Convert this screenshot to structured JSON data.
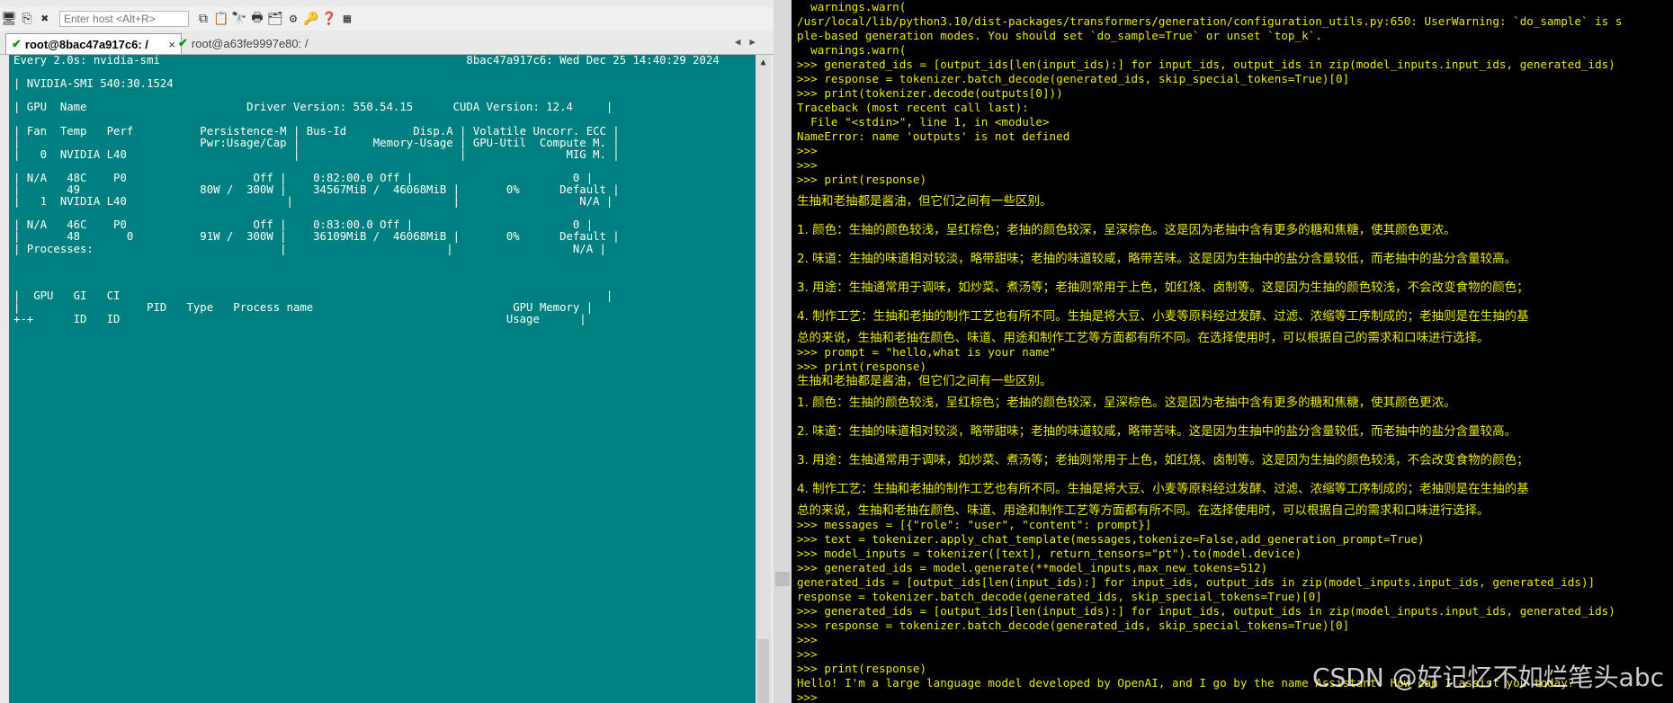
{
  "colors": {
    "terminal_left_bg": "#008080",
    "terminal_right_bg": "#000000",
    "terminal_right_fg": "#e8e800",
    "tab_check": "#0a9a0a"
  },
  "toolbar": {
    "host_placeholder": "Enter host <Alt+R>"
  },
  "tabs": [
    {
      "label": "root@8bac47a917c6: /",
      "active": true
    },
    {
      "label": "root@a63fe9997e80: /",
      "active": false
    }
  ],
  "left_terminal": {
    "lines": [
      "Every 2.0s: nvidia-smi                                              8bac47a917c6: Wed Dec 25 14:40:29 2024",
      "",
      "| NVIDIA-SMI 540:30.1524",
      "",
      "| GPU  Name                        Driver Version: 550.54.15      CUDA Version: 12.4     |",
      "",
      "| Fan  Temp   Perf          Persistence-M | Bus-Id          Disp.A | Volatile Uncorr. ECC |",
      "|                           Pwr:Usage/Cap |           Memory-Usage | GPU-Util  Compute M. |",
      "|   0  NVIDIA L40                         |                        |               MIG M. |",
      "",
      "| N/A   48C    P0                   Off |    0:82:00.0 Off |                        0 |",
      "|       49                  80W /  300W |    34567MiB /  46068MiB |       0%      Default |",
      "|   1  NVIDIA L40                        |                        |                  N/A |",
      "",
      "| N/A   46C    P0                   Off |    0:83:00.0 Off |                        0 |",
      "|       48       0          91W /  300W |    36109MiB /  46068MiB |       0%      Default |",
      "| Processes:                            |                        |                  N/A |",
      "",
      "",
      "",
      "|  GPU   GI   CI                                                                         |",
      "|                   PID   Type   Process name                              GPU Memory |",
      "+-+      ID   ID                                                          Usage      |"
    ]
  },
  "right_terminal": {
    "lines": [
      {
        "t": "  warnings.warn(",
        "k": "a"
      },
      {
        "t": "/usr/local/lib/python3.10/dist-packages/transformers/generation/configuration_utils.py:650: UserWarning: `do_sample` is s",
        "k": "a"
      },
      {
        "t": "ple-based generation modes. You should set `do_sample=True` or unset `top_k`.",
        "k": "a"
      },
      {
        "t": "  warnings.warn(",
        "k": "a"
      },
      {
        "t": ">>> generated_ids = [output_ids[len(input_ids):] for input_ids, output_ids in zip(model_inputs.input_ids, generated_ids)",
        "k": "a"
      },
      {
        "t": ">>> response = tokenizer.batch_decode(generated_ids, skip_special_tokens=True)[0]",
        "k": "a"
      },
      {
        "t": ">>> print(tokenizer.decode(outputs[0]))",
        "k": "a"
      },
      {
        "t": "Traceback (most recent call last):",
        "k": "a"
      },
      {
        "t": "  File \"<stdin>\", line 1, in <module>",
        "k": "a"
      },
      {
        "t": "NameError: name 'outputs' is not defined",
        "k": "a"
      },
      {
        "t": ">>>",
        "k": "a"
      },
      {
        "t": ">>>",
        "k": "a"
      },
      {
        "t": ">>> print(response)",
        "k": "a"
      },
      {
        "t": "生抽和老抽都是酱油，但它们之间有一些区别。",
        "k": "c"
      },
      {
        "t": "1. 颜色：生抽的颜色较浅，呈红棕色；老抽的颜色较深，呈深棕色。这是因为老抽中含有更多的糖和焦糖，使其颜色更浓。",
        "k": "c"
      },
      {
        "t": "2. 味道：生抽的味道相对较淡，略带甜味；老抽的味道较咸，略带苦味。这是因为生抽中的盐分含量较低，而老抽中的盐分含量较高。",
        "k": "c"
      },
      {
        "t": "3. 用途：生抽通常用于调味，如炒菜、煮汤等；老抽则常用于上色，如红烧、卤制等。这是因为生抽的颜色较浅，不会改变食物的颜色；",
        "k": "c"
      },
      {
        "t": "4. 制作工艺：生抽和老抽的制作工艺也有所不同。生抽是将大豆、小麦等原料经过发酵、过滤、浓缩等工序制成的；老抽则是在生抽的基",
        "k": "c"
      },
      {
        "t": "总的来说，生抽和老抽在颜色、味道、用途和制作工艺等方面都有所不同。在选择使用时，可以根据自己的需求和口味进行选择。",
        "k": "t"
      },
      {
        "t": ">>> prompt = \"hello,what is your name\"",
        "k": "a"
      },
      {
        "t": ">>> print(response)",
        "k": "a"
      },
      {
        "t": "生抽和老抽都是酱油，但它们之间有一些区别。",
        "k": "t"
      },
      {
        "t": "1. 颜色：生抽的颜色较浅，呈红棕色；老抽的颜色较深，呈深棕色。这是因为老抽中含有更多的糖和焦糖，使其颜色更浓。",
        "k": "c"
      },
      {
        "t": "2. 味道：生抽的味道相对较淡，略带甜味；老抽的味道较咸，略带苦味。这是因为生抽中的盐分含量较低，而老抽中的盐分含量较高。",
        "k": "c"
      },
      {
        "t": "3. 用途：生抽通常用于调味，如炒菜、煮汤等；老抽则常用于上色，如红烧、卤制等。这是因为生抽的颜色较浅，不会改变食物的颜色；",
        "k": "c"
      },
      {
        "t": "4. 制作工艺：生抽和老抽的制作工艺也有所不同。生抽是将大豆、小麦等原料经过发酵、过滤、浓缩等工序制成的；老抽则是在生抽的基",
        "k": "c"
      },
      {
        "t": "总的来说，生抽和老抽在颜色、味道、用途和制作工艺等方面都有所不同。在选择使用时，可以根据自己的需求和口味进行选择。",
        "k": "t"
      },
      {
        "t": ">>> messages = [{\"role\": \"user\", \"content\": prompt}]",
        "k": "a"
      },
      {
        "t": ">>> text = tokenizer.apply_chat_template(messages,tokenize=False,add_generation_prompt=True)",
        "k": "a"
      },
      {
        "t": ">>> model_inputs = tokenizer([text], return_tensors=\"pt\").to(model.device)",
        "k": "a"
      },
      {
        "t": ">>> generated_ids = model.generate(**model_inputs,max_new_tokens=512)",
        "k": "a"
      },
      {
        "t": "generated_ids = [output_ids[len(input_ids):] for input_ids, output_ids in zip(model_inputs.input_ids, generated_ids)]",
        "k": "a"
      },
      {
        "t": "response = tokenizer.batch_decode(generated_ids, skip_special_tokens=True)[0]",
        "k": "a"
      },
      {
        "t": ">>> generated_ids = [output_ids[len(input_ids):] for input_ids, output_ids in zip(model_inputs.input_ids, generated_ids)",
        "k": "a"
      },
      {
        "t": ">>> response = tokenizer.batch_decode(generated_ids, skip_special_tokens=True)[0]",
        "k": "a"
      },
      {
        "t": ">>>",
        "k": "a"
      },
      {
        "t": ">>>",
        "k": "a"
      },
      {
        "t": ">>> print(response)",
        "k": "a"
      },
      {
        "t": "Hello! I'm a large language model developed by OpenAI, and I go by the name Assistant. How can I assist you today?",
        "k": "a"
      },
      {
        "t": ">>>",
        "k": "a"
      }
    ]
  },
  "watermark": "CSDN @好记忆不如烂笔头abc"
}
